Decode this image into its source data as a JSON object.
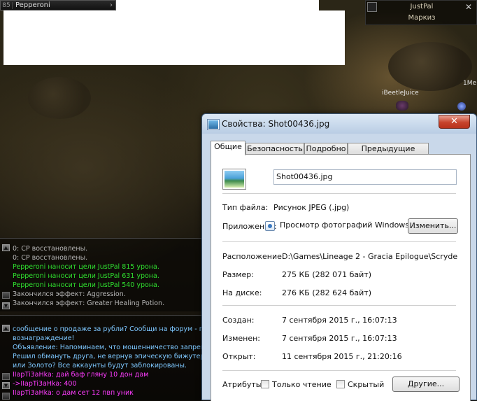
{
  "game": {
    "party": {
      "level": "85",
      "name": "Pepperoni"
    },
    "target": {
      "name": "JustPal",
      "title": "Маркиз"
    },
    "npc_labels": [
      "iBeetleJuice",
      "1Me"
    ],
    "combat_log": [
      {
        "text": "0: CP восстановлены.",
        "color": "#b8b8b8"
      },
      {
        "text": "0: CP восстановлены.",
        "color": "#b8b8b8"
      },
      {
        "text": "Pepperoni наносит цели JustPal 815 урона.",
        "color": "#2fe02f"
      },
      {
        "text": "Pepperoni наносит цели JustPal 631 урона.",
        "color": "#2fe02f"
      },
      {
        "text": "Pepperoni наносит цели JustPal 540 урона.",
        "color": "#2fe02f"
      },
      {
        "text": "Закончился эффект: Aggression.",
        "color": "#b8b8b8"
      },
      {
        "text": "Закончился эффект: Greater Healing Potion.",
        "color": "#b8b8b8"
      }
    ],
    "chat_log": [
      {
        "text": "сообщение о продаже за рубли? Сообщи на форум - полу",
        "color": "#7ec8ff"
      },
      {
        "text": "вознаграждение!",
        "color": "#7ec8ff"
      },
      {
        "text": "Объявление: Напоминаем, что мошенничество запрещен",
        "color": "#7ec8ff"
      },
      {
        "text": "Решил обмануть друга, не вернув эпическую бижутерию",
        "color": "#7ec8ff"
      },
      {
        "text": "или Золото? Все аккаунты будут заблокированы.",
        "color": "#7ec8ff"
      },
      {
        "text": "IIapTi3aHka:  дай баф гляну 10 дон дам",
        "color": "#ff3cff"
      },
      {
        "text": "->IIapTi3aHka: 400",
        "color": "#ff3cff"
      },
      {
        "text": "IIapTi3aHka:  о дам сет 12 пвп уник",
        "color": "#ff3cff"
      }
    ]
  },
  "dialog": {
    "title": "Свойства: Shot00436.jpg",
    "close_label": "✕",
    "tabs": [
      "Общие",
      "Безопасность",
      "Подробно",
      "Предыдущие версии"
    ],
    "active_tab": "Общие",
    "filename": "Shot00436.jpg",
    "file_type_label": "Тип файла:",
    "file_type_value": "Рисунок JPEG (.jpg)",
    "app_label": "Приложение:",
    "app_value": "Просмотр фотографий Windows",
    "change_button": "Изменить...",
    "location_label": "Расположение:",
    "location_value": "D:\\Games\\Lineage 2 - Gracia Epilogue\\Scryde",
    "size_label": "Размер:",
    "size_value": "275 КБ (282 071 байт)",
    "disk_label": "На диске:",
    "disk_value": "276 КБ (282 624 байт)",
    "created_label": "Создан:",
    "created_value": "7 сентября 2015 г., 16:07:13",
    "modified_label": "Изменен:",
    "modified_value": "7 сентября 2015 г., 16:07:13",
    "opened_label": "Открыт:",
    "opened_value": "11 сентября 2015 г., 21:20:16",
    "attributes_label": "Атрибуты:",
    "readonly_label": "Только чтение",
    "hidden_label": "Скрытый",
    "other_button": "Другие..."
  }
}
